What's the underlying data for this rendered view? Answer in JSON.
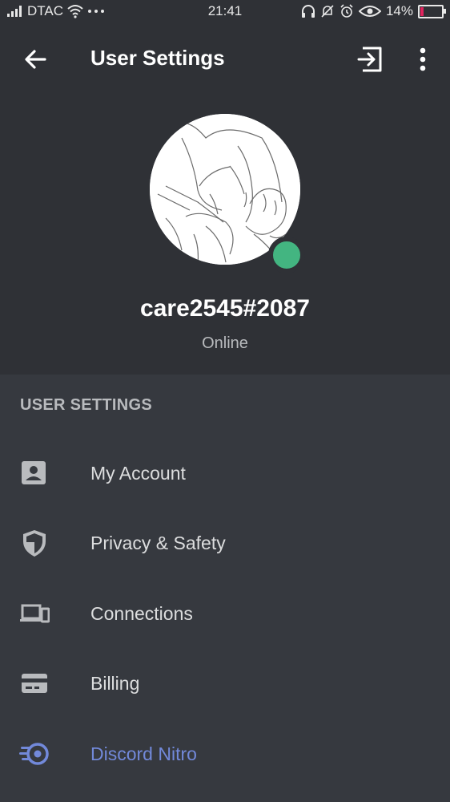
{
  "status_bar": {
    "carrier": "DTAC",
    "time": "21:41",
    "battery_percent": "14%",
    "icons": [
      "signal-icon",
      "wifi-icon",
      "more-dots-icon",
      "headphone-icon",
      "mute-icon",
      "alarm-icon",
      "eye-icon",
      "battery-icon"
    ]
  },
  "app_bar": {
    "title": "User Settings",
    "icons": [
      "back-arrow-icon",
      "logout-icon",
      "more-vertical-icon"
    ]
  },
  "profile": {
    "username": "care2545#2087",
    "status": "Online",
    "status_color": "#43b581"
  },
  "settings": {
    "section_title": "USER SETTINGS",
    "items": [
      {
        "label": "My Account",
        "icon": "account-icon"
      },
      {
        "label": "Privacy & Safety",
        "icon": "shield-icon"
      },
      {
        "label": "Connections",
        "icon": "devices-icon"
      },
      {
        "label": "Billing",
        "icon": "card-icon"
      },
      {
        "label": "Discord Nitro",
        "icon": "nitro-icon"
      }
    ]
  },
  "colors": {
    "background": "#36393f",
    "header_background": "#2f3136",
    "accent": "#7289da",
    "text_muted": "#b9bbbe",
    "online": "#43b581"
  }
}
